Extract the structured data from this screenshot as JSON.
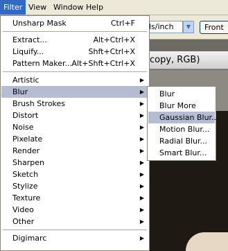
{
  "menubar": {
    "items": [
      {
        "label": "Filter",
        "active": true
      },
      {
        "label": "View",
        "active": false
      },
      {
        "label": "Window",
        "active": false
      },
      {
        "label": "Help",
        "active": false
      }
    ]
  },
  "options_bar": {
    "resolution_unit": "ls/inch",
    "front_button": "Front"
  },
  "document": {
    "title": "copy, RGB)"
  },
  "filter_menu": {
    "groups": [
      [
        {
          "label": "Unsharp Mask",
          "shortcut": "Ctrl+F"
        }
      ],
      [
        {
          "label": "Extract...",
          "shortcut": "Alt+Ctrl+X"
        },
        {
          "label": "Liquify...",
          "shortcut": "Shft+Ctrl+X"
        },
        {
          "label": "Pattern Maker...",
          "shortcut": "Alt+Shft+Ctrl+X"
        }
      ],
      [
        {
          "label": "Artistic",
          "submenu": true
        },
        {
          "label": "Blur",
          "submenu": true,
          "highlighted": true
        },
        {
          "label": "Brush Strokes",
          "submenu": true
        },
        {
          "label": "Distort",
          "submenu": true
        },
        {
          "label": "Noise",
          "submenu": true
        },
        {
          "label": "Pixelate",
          "submenu": true
        },
        {
          "label": "Render",
          "submenu": true
        },
        {
          "label": "Sharpen",
          "submenu": true
        },
        {
          "label": "Sketch",
          "submenu": true
        },
        {
          "label": "Stylize",
          "submenu": true
        },
        {
          "label": "Texture",
          "submenu": true
        },
        {
          "label": "Video",
          "submenu": true
        },
        {
          "label": "Other",
          "submenu": true
        }
      ],
      [
        {
          "label": "Digimarc",
          "submenu": true
        }
      ]
    ]
  },
  "blur_submenu": {
    "items": [
      {
        "label": "Blur"
      },
      {
        "label": "Blur More"
      },
      {
        "label": "Gaussian Blur...",
        "highlighted": true
      },
      {
        "label": "Motion Blur..."
      },
      {
        "label": "Radial Blur..."
      },
      {
        "label": "Smart Blur..."
      }
    ]
  },
  "icons": {
    "submenu_arrow": "submenu-arrow-icon",
    "dropdown_arrow": "chevron-down-icon"
  },
  "colors": {
    "menubar_active": "#316ac5",
    "menu_highlight": "#b6bdd2"
  }
}
